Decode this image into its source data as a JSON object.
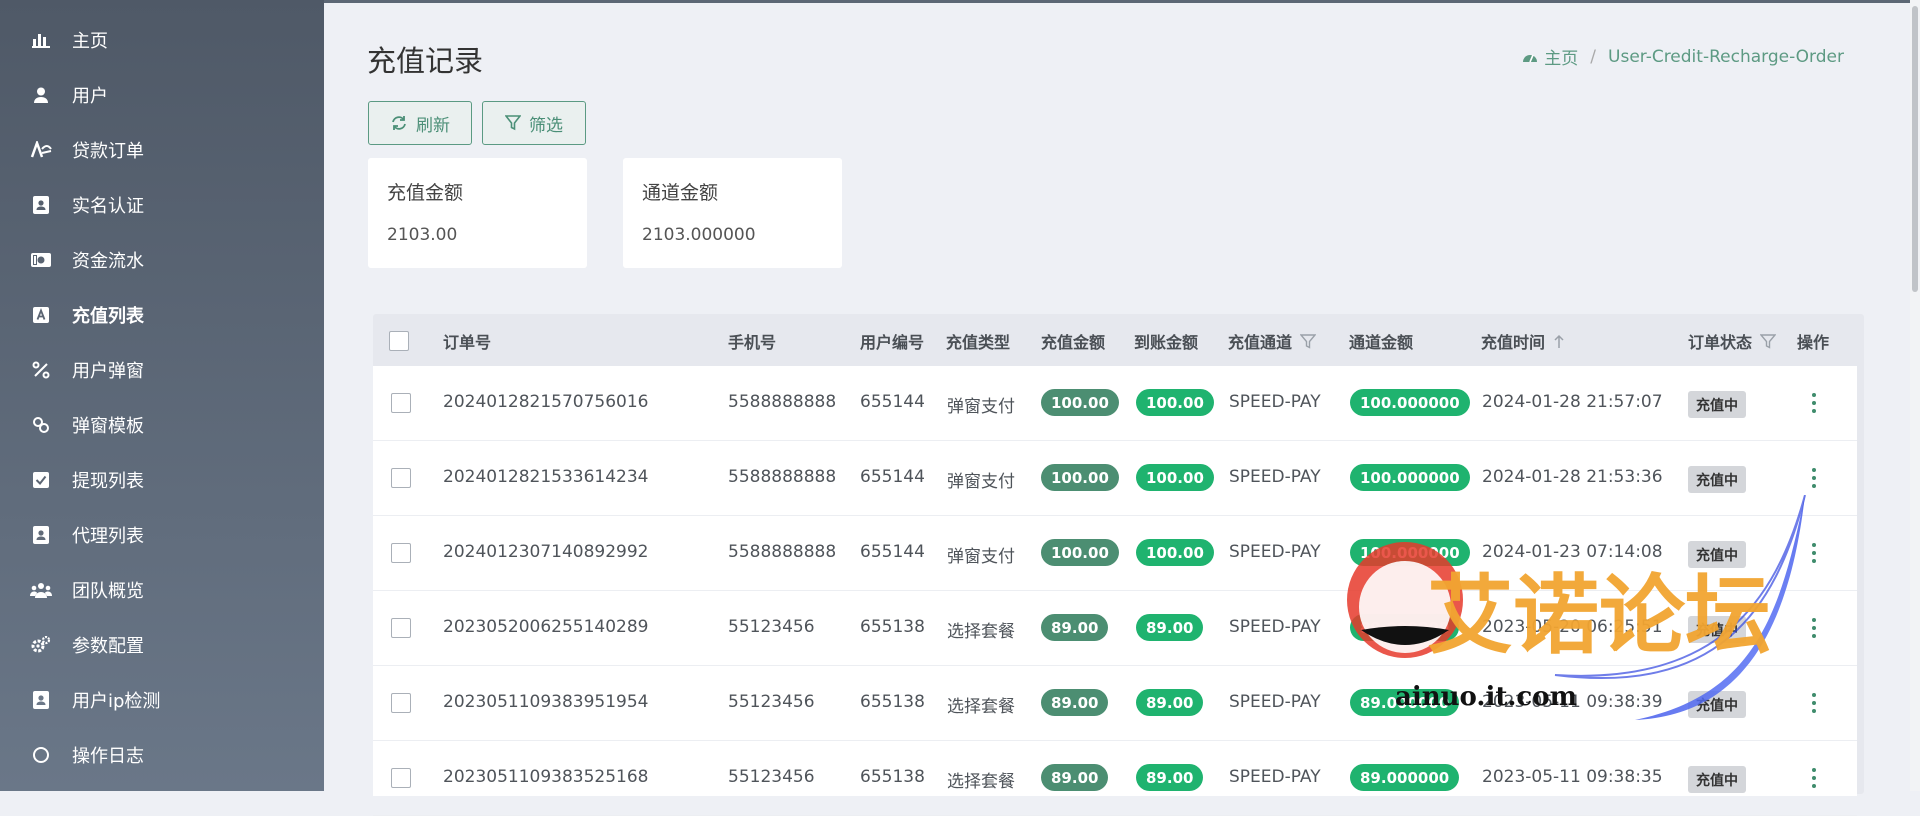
{
  "sidebar": {
    "items": [
      {
        "label": "主页",
        "icon": "bar-chart-icon"
      },
      {
        "label": "用户",
        "icon": "user-icon"
      },
      {
        "label": "贷款订单",
        "icon": "loan-icon"
      },
      {
        "label": "实名认证",
        "icon": "id-card-icon"
      },
      {
        "label": "资金流水",
        "icon": "money-icon"
      },
      {
        "label": "充值列表",
        "icon": "recharge-icon",
        "active": true
      },
      {
        "label": "用户弹窗",
        "icon": "popup-icon"
      },
      {
        "label": "弹窗模板",
        "icon": "link-icon"
      },
      {
        "label": "提现列表",
        "icon": "check-square-icon"
      },
      {
        "label": "代理列表",
        "icon": "agent-icon"
      },
      {
        "label": "团队概览",
        "icon": "team-icon"
      },
      {
        "label": "参数配置",
        "icon": "cogs-icon"
      },
      {
        "label": "用户ip检测",
        "icon": "ip-check-icon"
      },
      {
        "label": "操作日志",
        "icon": "circle-icon"
      }
    ]
  },
  "page": {
    "title": "充值记录",
    "breadcrumb_home": "主页",
    "breadcrumb_current": "User-Credit-Recharge-Order"
  },
  "toolbar": {
    "refresh": "刷新",
    "filter": "筛选"
  },
  "stats": [
    {
      "title": "充值金额",
      "value": "2103.00"
    },
    {
      "title": "通道金额",
      "value": "2103.000000"
    }
  ],
  "table": {
    "columns": [
      "订单号",
      "手机号",
      "用户编号",
      "充值类型",
      "充值金额",
      "到账金额",
      "充值通道",
      "通道金额",
      "充值时间",
      "订单状态",
      "操作"
    ],
    "rows": [
      {
        "order": "2024012821570756016",
        "phone": "5588888888",
        "uid": "655144",
        "type": "弹窗支付",
        "amount": "100.00",
        "received": "100.00",
        "channel": "SPEED-PAY",
        "channel_amount": "100.000000",
        "time": "2024-01-28 21:57:07",
        "status": "充值中"
      },
      {
        "order": "2024012821533614234",
        "phone": "5588888888",
        "uid": "655144",
        "type": "弹窗支付",
        "amount": "100.00",
        "received": "100.00",
        "channel": "SPEED-PAY",
        "channel_amount": "100.000000",
        "time": "2024-01-28 21:53:36",
        "status": "充值中"
      },
      {
        "order": "2024012307140892992",
        "phone": "5588888888",
        "uid": "655144",
        "type": "弹窗支付",
        "amount": "100.00",
        "received": "100.00",
        "channel": "SPEED-PAY",
        "channel_amount": "100.000000",
        "time": "2024-01-23 07:14:08",
        "status": "充值中"
      },
      {
        "order": "2023052006255140289",
        "phone": "55123456",
        "uid": "655138",
        "type": "选择套餐",
        "amount": "89.00",
        "received": "89.00",
        "channel": "SPEED-PAY",
        "channel_amount": "89.000000",
        "time": "2023-05-20 06:25:51",
        "status": "充值中"
      },
      {
        "order": "2023051109383951954",
        "phone": "55123456",
        "uid": "655138",
        "type": "选择套餐",
        "amount": "89.00",
        "received": "89.00",
        "channel": "SPEED-PAY",
        "channel_amount": "89.000000",
        "time": "2023-05-11 09:38:39",
        "status": "充值中"
      },
      {
        "order": "2023051109383525168",
        "phone": "55123456",
        "uid": "655138",
        "type": "选择套餐",
        "amount": "89.00",
        "received": "89.00",
        "channel": "SPEED-PAY",
        "channel_amount": "89.000000",
        "time": "2023-05-11 09:38:35",
        "status": "充值中"
      }
    ]
  },
  "watermark": {
    "text": "艾诺论坛",
    "url": "ainuo.it.com"
  }
}
